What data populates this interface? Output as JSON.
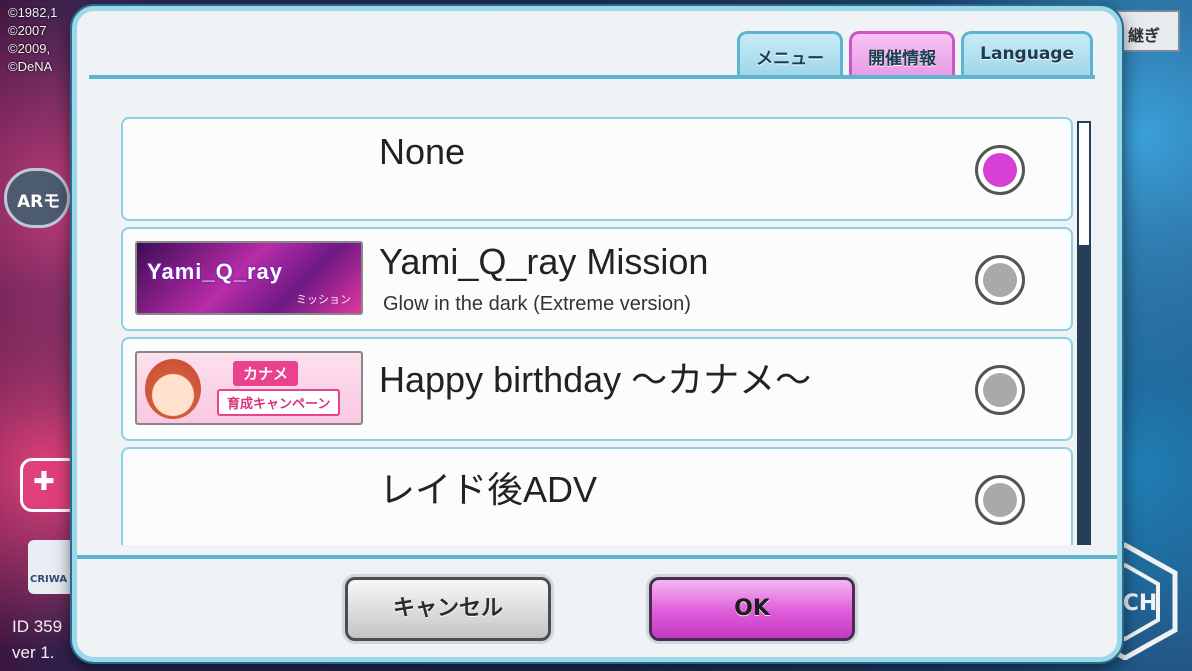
{
  "background": {
    "copyright_lines": [
      "©1982,1",
      "©2007",
      "©2009,",
      "©DeNA"
    ],
    "ar_label": "ARモ",
    "criware_label": "CRIWA",
    "id_lines": [
      "ID 359",
      "ver 1."
    ],
    "takeover_label": "継ぎ",
    "watermark_label": "TECH"
  },
  "dialog": {
    "tabs": [
      {
        "label": "メニュー",
        "active": false
      },
      {
        "label": "開催情報",
        "active": true
      },
      {
        "label": "Language",
        "active": false
      }
    ],
    "items": [
      {
        "title": "None",
        "subtitle": "",
        "selected": true
      },
      {
        "title": "Yami_Q_ray Mission",
        "subtitle": "Glow in the dark (Extreme version)",
        "selected": false,
        "thumbnail": {
          "title": "Yami_Q_ray",
          "sub": "ミッション"
        }
      },
      {
        "title": "Happy birthday ～カナメ～",
        "subtitle": "",
        "selected": false,
        "thumbnail": {
          "line1": "カナメ",
          "line2": "育成キャンペーン"
        }
      },
      {
        "title": "レイド後ADV",
        "subtitle": "",
        "selected": false
      }
    ],
    "buttons": {
      "cancel": "キャンセル",
      "ok": "OK"
    }
  },
  "colors": {
    "accent_tab": "#e79ae6",
    "dialog_border": "#9dd8ea",
    "radio_selected": "#d740d4",
    "radio_unselected": "#a9a9a9"
  }
}
